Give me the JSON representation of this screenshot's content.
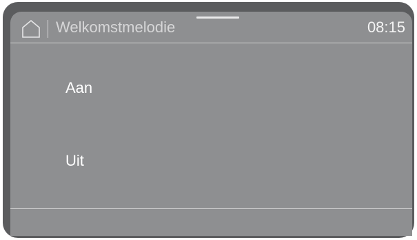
{
  "header": {
    "home_icon": "home-icon",
    "title": "Welkomstmelodie",
    "time": "08:15"
  },
  "options": [
    {
      "label": "Aan"
    },
    {
      "label": "Uit"
    }
  ],
  "colors": {
    "bezel": "#5b5c5e",
    "screen": "#8e8f91",
    "text": "#ffffff",
    "title_text": "#d6d6d7",
    "divider": "#d2d2d3"
  }
}
